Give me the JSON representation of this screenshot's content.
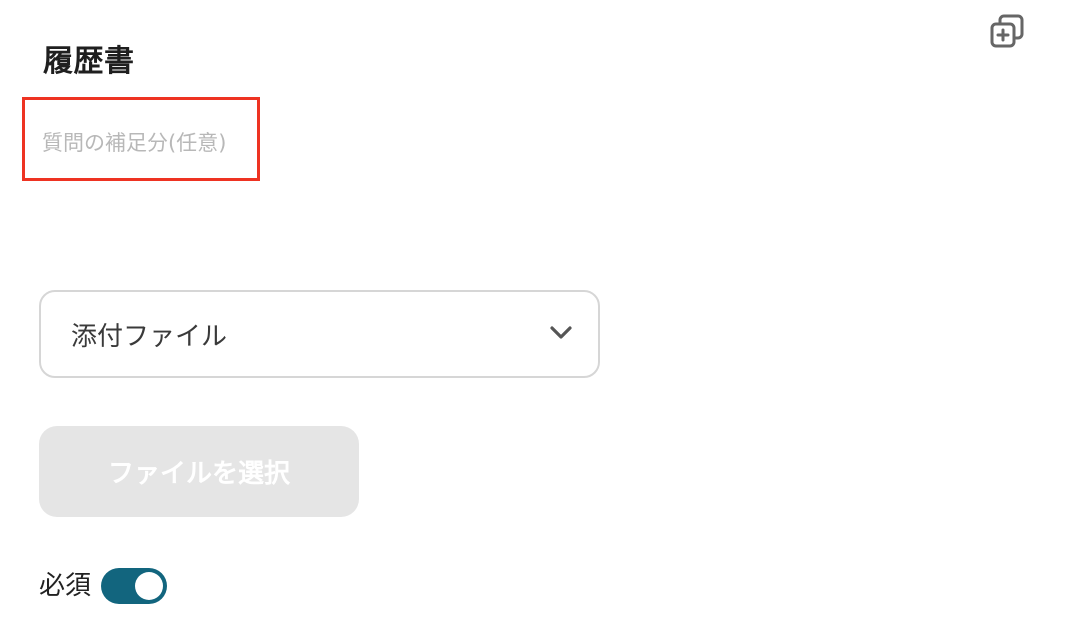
{
  "field": {
    "title": "履歴書",
    "description_placeholder": "質問の補足分(任意)",
    "description_value": ""
  },
  "type_select": {
    "selected_label": "添付ファイル"
  },
  "file_button": {
    "label": "ファイルを選択"
  },
  "required": {
    "label": "必須",
    "enabled": true
  },
  "icons": {
    "duplicate": "duplicate-icon",
    "chevron": "chevron-down-icon"
  },
  "colors": {
    "highlight_border": "#ee3322",
    "toggle_on": "#12657e",
    "button_disabled_bg": "#e5e5e5"
  }
}
